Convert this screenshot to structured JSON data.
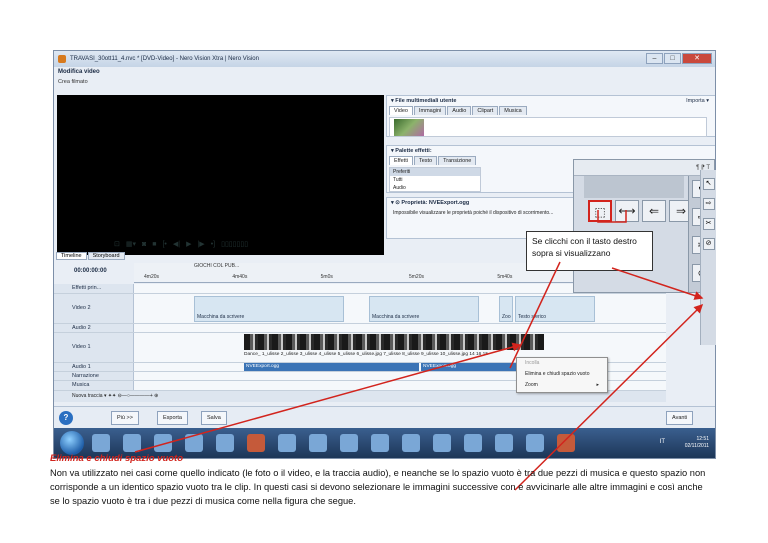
{
  "window": {
    "title": "TRAVASI_30ott11_4.nvc * [DVD-Video] - Nero Vision Xtra | Nero Vision",
    "heading": "Modifica video",
    "subheading": "Crea filmato",
    "controls": [
      "–",
      "□",
      "✕"
    ]
  },
  "media_panel": {
    "title": "▾ File multimediali utente",
    "import_label": "Importa ▾",
    "tabs": [
      "Video",
      "Immagini",
      "Audio",
      "Clipart",
      "Musica"
    ]
  },
  "effects_panel": {
    "title": "▾ Palette effetti:",
    "tabs": [
      "Effetti",
      "Testo",
      "Transizione"
    ],
    "list": [
      "Preferiti",
      "Tutti",
      "Audio"
    ]
  },
  "properties_panel": {
    "title": "▾ ⊙ Proprietà: NVEExport.ogg",
    "text": "Impossibile visualizzare le proprietà poiché il dispositivo di scorrimento...",
    "overflow_text": "nato."
  },
  "transport": {
    "buttons": [
      "⊡",
      "▦▾",
      "◙",
      "■",
      "[•",
      "◀|",
      "▶",
      "|▶",
      "•]",
      "▯▯▯▯▯▯▯"
    ]
  },
  "timeline": {
    "tabs": [
      "Timeline",
      "Storyboard"
    ],
    "timecode": "00:00:00:00",
    "marker": "GIOCHI COL PUB...",
    "ruler_ticks": [
      "4m20s",
      "4m40s",
      "5m0s",
      "5m20s",
      "5m40s",
      "6m0s"
    ],
    "tracks": [
      {
        "name": "Effetti prin..."
      },
      {
        "name": "Video 2"
      },
      {
        "name": "Audio 2"
      },
      {
        "name": "Video 1"
      },
      {
        "name": "Audio 1"
      },
      {
        "name": "Narrazione"
      },
      {
        "name": "Musica"
      }
    ],
    "video2_clips": [
      "Macchina da scrivere",
      "Macchina da scrivere",
      "Zoo",
      "Testo sferico"
    ],
    "video1_clips": "Dance_  1_ulisse  2_ulisse  3_ulisse  4_ulisse  5_ulisse  6_ulisse.jpg        7_ulisse  8_ulisse  9_ulisse  10_ulisse.jpg                             14  16  15",
    "audio1_clips": [
      "NVEExport.ogg",
      "NVEExport.ogg"
    ],
    "toolbar": "Nuova traccia ▾   ✦✦   ⊖—○————+  ⊕"
  },
  "context_menu": {
    "items": [
      "Incolla",
      "Elimina e chiudi spazio vuoto",
      "Zoom"
    ],
    "zoom_arrow": "▸"
  },
  "footer": {
    "help": "?",
    "buttons": [
      "Più >>",
      "Esporta",
      "Salva"
    ],
    "next": "Avanti"
  },
  "taskbar": {
    "lang": "IT",
    "time": "12:51",
    "date": "02/11/2011"
  },
  "callout": {
    "buttons": [
      "⬚",
      "⟷",
      "⇐",
      "⇒"
    ],
    "side_buttons": [
      "↖",
      "⇨",
      "✂",
      "⊘"
    ]
  },
  "note_box": {
    "line1": "Se clicchi con il tasto destro",
    "line2": "sopra    si  visualizzano"
  },
  "caption": {
    "title": "Elimina e chiudi spazio vuoto",
    "paragraph1": "Non va utilizzato nei casi come quello indicato (le foto o il video, e la traccia audio), e neanche se lo spazio vuoto è tra due pezzi  di musica e questo spazio non",
    "paragraph2": "corrisponde a un identico  spazio vuoto tra le clip. In questi casi si devono selezionare le immagini successive con     e avvicinarle alle altre immagini e così anche",
    "paragraph3": "se lo spazio vuoto è tra i due pezzi di musica come nella figura che segue."
  },
  "colors": {
    "annotation": "#d2241d",
    "accent": "#3b74b6",
    "taskbar": "#1c3556"
  }
}
